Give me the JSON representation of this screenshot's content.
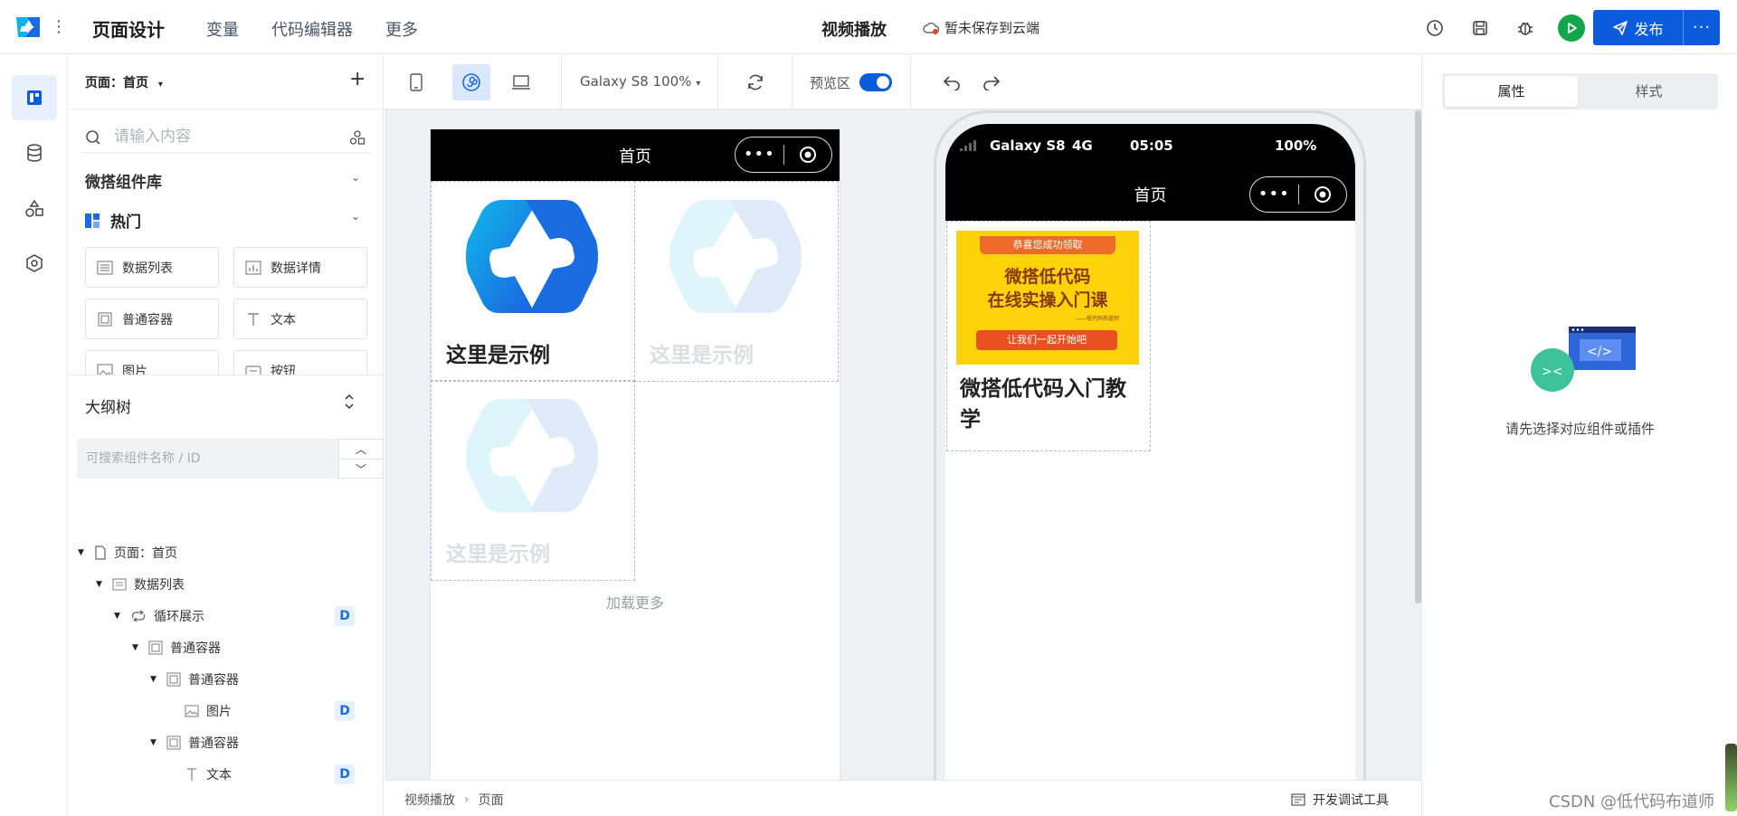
{
  "topbar": {
    "title": "页面设计",
    "menu": [
      "变量",
      "代码编辑器",
      "更多"
    ],
    "page_name": "视频播放",
    "save_status": "暂未保存到云端",
    "publish_label": "发布",
    "brand_color": "#0b5cdd"
  },
  "left_panel": {
    "page_selector": "页面：首页",
    "search_placeholder": "请输入内容",
    "library_title": "微搭组件库",
    "hot_title": "热门",
    "components": [
      {
        "label": "数据列表",
        "icon": "list-icon"
      },
      {
        "label": "数据详情",
        "icon": "chart-icon"
      },
      {
        "label": "普通容器",
        "icon": "container-icon"
      },
      {
        "label": "文本",
        "icon": "text-icon"
      },
      {
        "label": "图片",
        "icon": "image-icon"
      },
      {
        "label": "按钮",
        "icon": "button-icon"
      }
    ],
    "tree_title": "大纲树",
    "tree_search_placeholder": "可搜索组件名称 / ID",
    "tree": [
      {
        "label": "页面：首页",
        "icon": "page-icon",
        "badge": ""
      },
      {
        "label": "数据列表",
        "icon": "list-icon",
        "badge": ""
      },
      {
        "label": "循环展示",
        "icon": "loop-icon",
        "badge": "D"
      },
      {
        "label": "普通容器",
        "icon": "container-icon",
        "badge": ""
      },
      {
        "label": "普通容器",
        "icon": "container-icon",
        "badge": ""
      },
      {
        "label": "图片",
        "icon": "image-icon",
        "badge": "D"
      },
      {
        "label": "普通容器",
        "icon": "container-icon",
        "badge": ""
      },
      {
        "label": "文本",
        "icon": "text-icon",
        "badge": "D"
      }
    ]
  },
  "canvas": {
    "zoom": "Galaxy S8 100%",
    "preview_label": "预览区",
    "preview_on": true,
    "design_page_title": "首页",
    "cell_title": "这里是示例",
    "load_more": "加载更多",
    "footer_crumbs": [
      "视频播放",
      "页面"
    ],
    "devtools_label": "开发调试工具"
  },
  "preview": {
    "carrier": "Galaxy S8",
    "network": "4G",
    "time": "05:05",
    "battery": "100%",
    "page_title": "首页",
    "banner_top": "恭喜您成功领取",
    "banner_line1": "微搭低代码",
    "banner_line2": "在线实操入门课",
    "banner_note": "——低代码布道师",
    "banner_button": "让我们一起开始吧",
    "card_title": "微搭低代码入门教学"
  },
  "right_panel": {
    "tabs": [
      "属性",
      "样式"
    ],
    "active_tab": 0,
    "empty_text": "请先选择对应组件或插件"
  },
  "watermark": "CSDN @低代码布道师"
}
